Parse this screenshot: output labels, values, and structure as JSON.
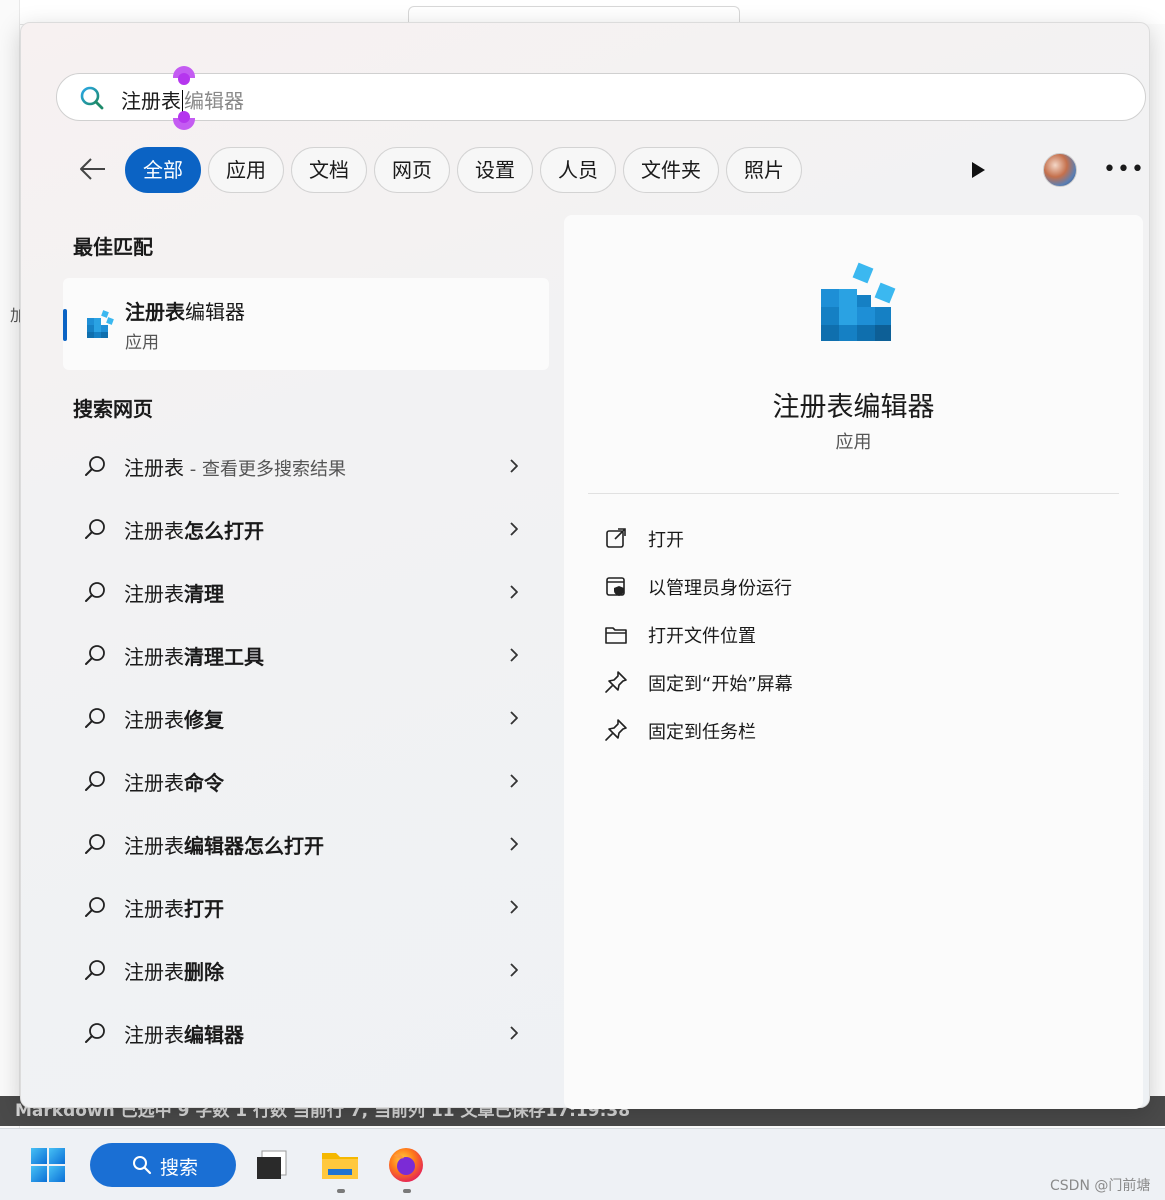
{
  "background": {
    "side_char": "加",
    "status_bar": "Markdown 已选中  9 字数  1 行数  当前行 7, 当前列 11  文章已保存17:19:38"
  },
  "search": {
    "typed": "注册表",
    "suggestion": "编辑器"
  },
  "filters": [
    {
      "label": "全部",
      "active": true
    },
    {
      "label": "应用",
      "active": false
    },
    {
      "label": "文档",
      "active": false
    },
    {
      "label": "网页",
      "active": false
    },
    {
      "label": "设置",
      "active": false
    },
    {
      "label": "人员",
      "active": false
    },
    {
      "label": "文件夹",
      "active": false
    },
    {
      "label": "照片",
      "active": false
    }
  ],
  "best_match": {
    "section_title": "最佳匹配",
    "name_bold": "注册表",
    "name_rest": "编辑器",
    "type": "应用"
  },
  "web": {
    "section_title": "搜索网页",
    "items": [
      {
        "prefix": "注册表",
        "bold": "",
        "hint": " - 查看更多搜索结果"
      },
      {
        "prefix": "注册表",
        "bold": "怎么打开",
        "hint": ""
      },
      {
        "prefix": "注册表",
        "bold": "清理",
        "hint": ""
      },
      {
        "prefix": "注册表",
        "bold": "清理工具",
        "hint": ""
      },
      {
        "prefix": "注册表",
        "bold": "修复",
        "hint": ""
      },
      {
        "prefix": "注册表",
        "bold": "命令",
        "hint": ""
      },
      {
        "prefix": "注册表",
        "bold": "编辑器怎么打开",
        "hint": ""
      },
      {
        "prefix": "注册表",
        "bold": "打开",
        "hint": ""
      },
      {
        "prefix": "注册表",
        "bold": "删除",
        "hint": ""
      },
      {
        "prefix": "注册表",
        "bold": "编辑器",
        "hint": ""
      }
    ]
  },
  "preview": {
    "name": "注册表编辑器",
    "type": "应用",
    "actions": [
      {
        "label": "打开",
        "icon": "open-external-icon"
      },
      {
        "label": "以管理员身份运行",
        "icon": "shield-admin-icon"
      },
      {
        "label": "打开文件位置",
        "icon": "folder-icon"
      },
      {
        "label": "固定到“开始”屏幕",
        "icon": "pin-icon"
      },
      {
        "label": "固定到任务栏",
        "icon": "pin-icon"
      }
    ]
  },
  "taskbar": {
    "search_label": "搜索"
  },
  "watermark": "CSDN @门前塘",
  "colors": {
    "accent": "#0b63c4",
    "taskbar_search": "#1a6fd4"
  }
}
